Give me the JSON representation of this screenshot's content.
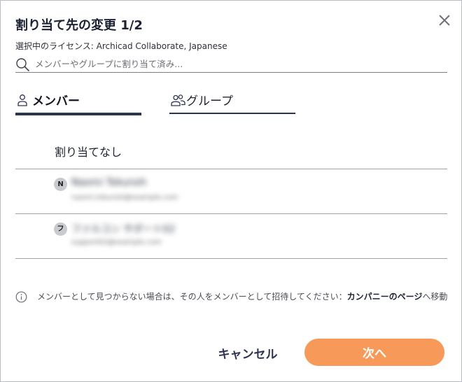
{
  "dialog": {
    "title": "割り当て先の変更 1/2",
    "license_text": "選択中のライセンス: Archicad Collaborate, Japanese"
  },
  "search": {
    "placeholder": "メンバーやグループに割り当て済み..."
  },
  "tabs": [
    {
      "label": "メンバー",
      "active": true,
      "icon": "person-icon"
    },
    {
      "label": "グループ",
      "active": false,
      "icon": "group-icon"
    }
  ],
  "list": {
    "no_assignment_label": "割り当てなし",
    "members": [
      {
        "avatar_letter": "N",
        "name": "Naomi Tokunoh",
        "email": "naomi.tokunoh@example.com"
      },
      {
        "avatar_letter": "フ",
        "name": "ファルコン サポート02",
        "email": "support02@example.com"
      }
    ]
  },
  "info": {
    "icon": "info-icon",
    "text": "メンバーとして見つからない場合は、その人をメンバーとして招待してください：",
    "link_text": "カンパニーのページ",
    "suffix": "へ移動"
  },
  "buttons": {
    "cancel_label": "キャンセル",
    "next_label": "次へ"
  },
  "colors": {
    "accent": "#f79a59",
    "navy": "#2c3450",
    "divider": "#9ea1a8"
  }
}
